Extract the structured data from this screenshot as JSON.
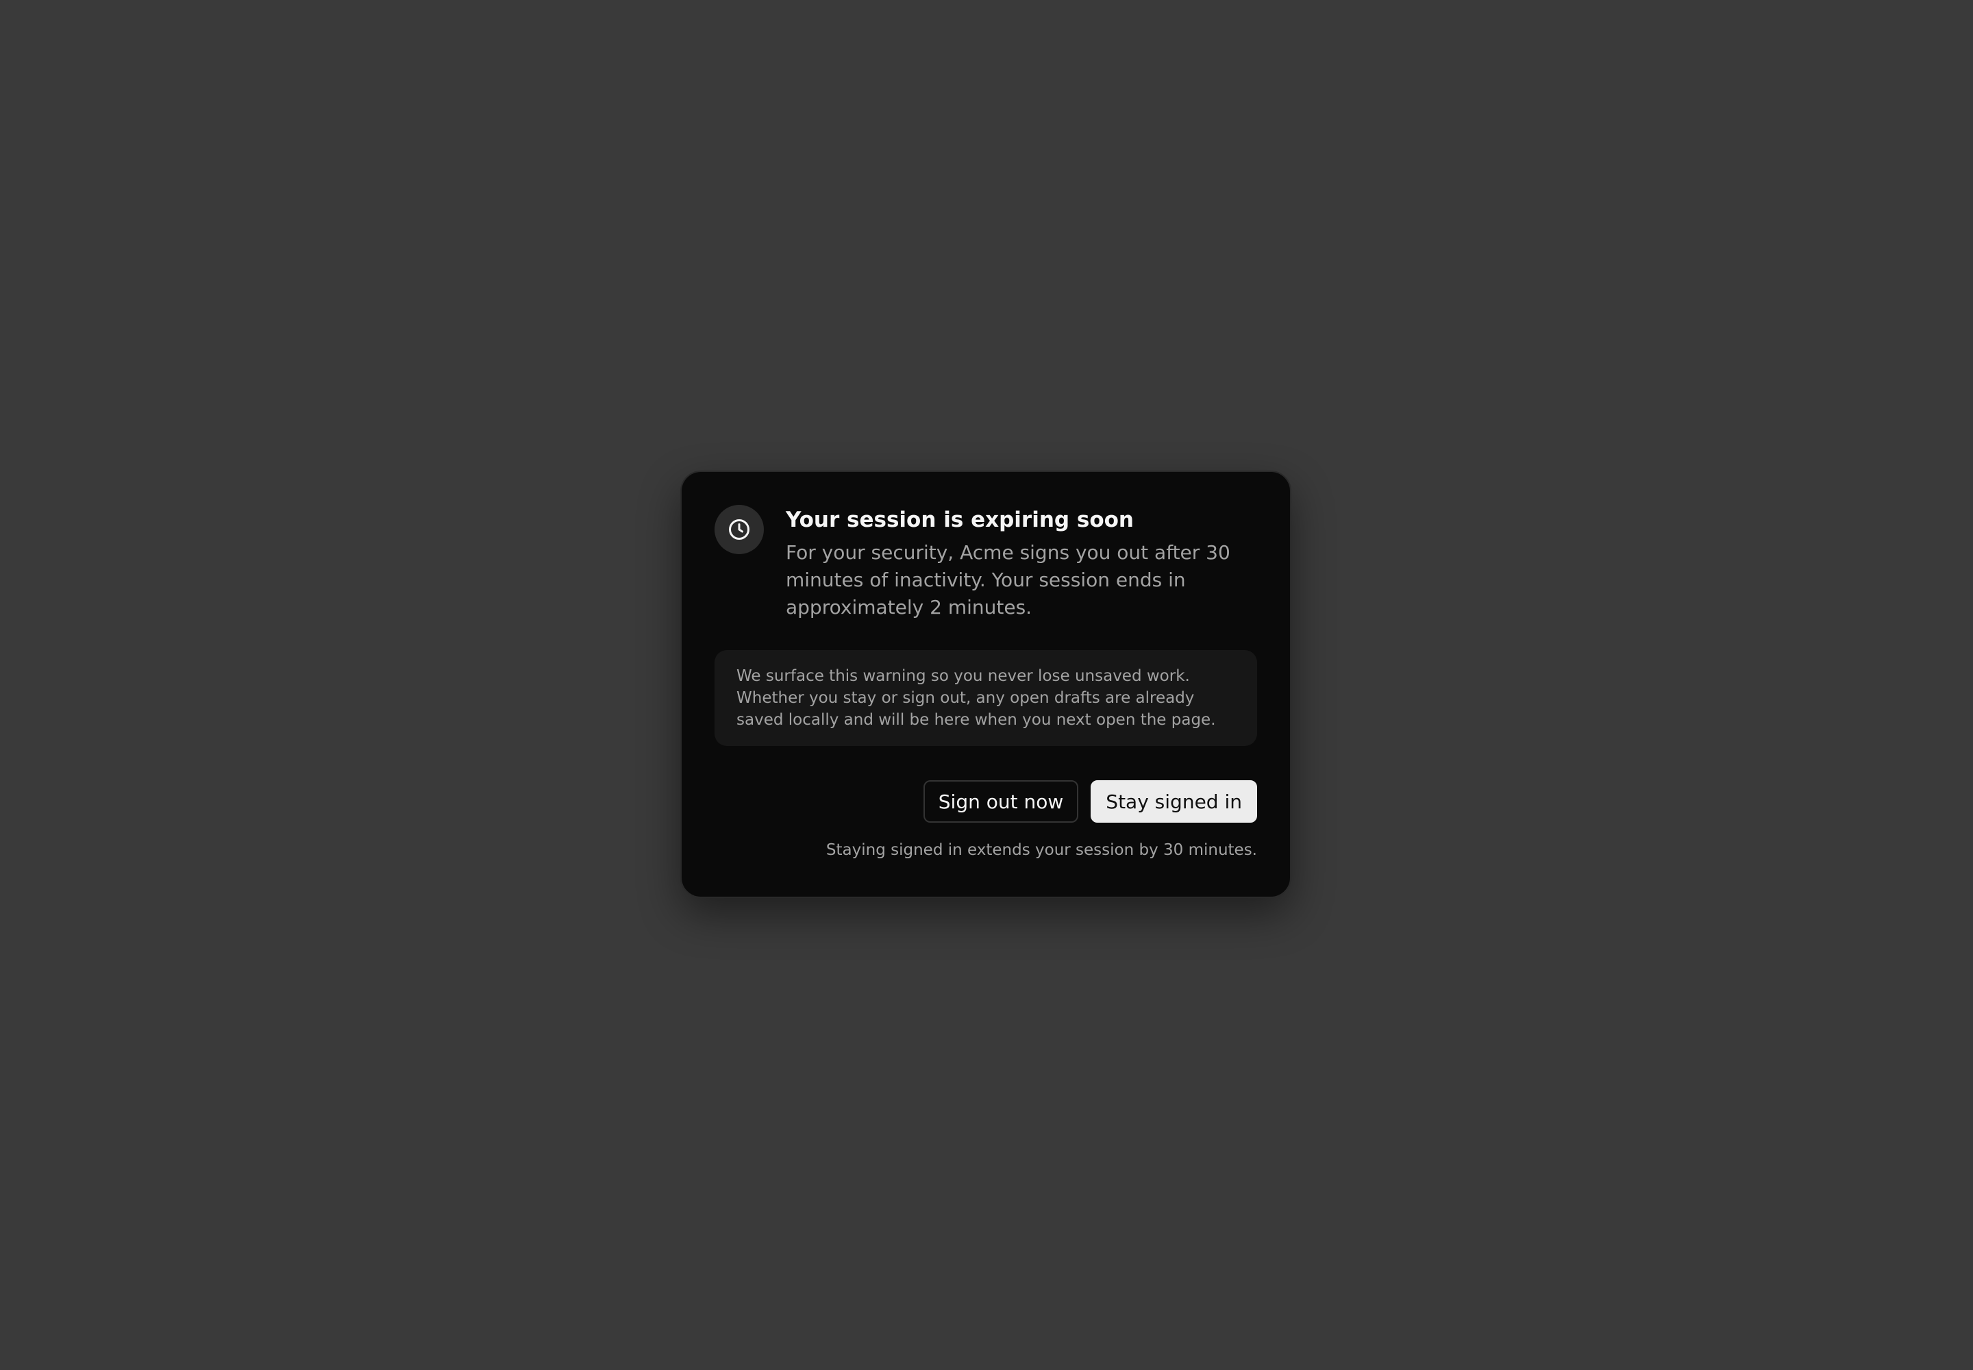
{
  "dialog": {
    "icon": "clock-icon",
    "title": "Your session is expiring soon",
    "description": "For your security, Acme signs you out after 30 minutes of inactivity. Your session ends in approximately 2 minutes.",
    "note": "We surface this warning so you never lose unsaved work. Whether you stay or sign out, any open drafts are already saved locally and will be here when you next open the page.",
    "sign_out_label": "Sign out now",
    "stay_label": "Stay signed in",
    "footnote": "Staying signed in extends your session by 30 minutes."
  },
  "colors": {
    "backdrop": "#3a3a3a",
    "dialog_bg": "#0a0a0a",
    "primary_button_bg": "#ececec",
    "muted_text": "#a3a3a3"
  }
}
